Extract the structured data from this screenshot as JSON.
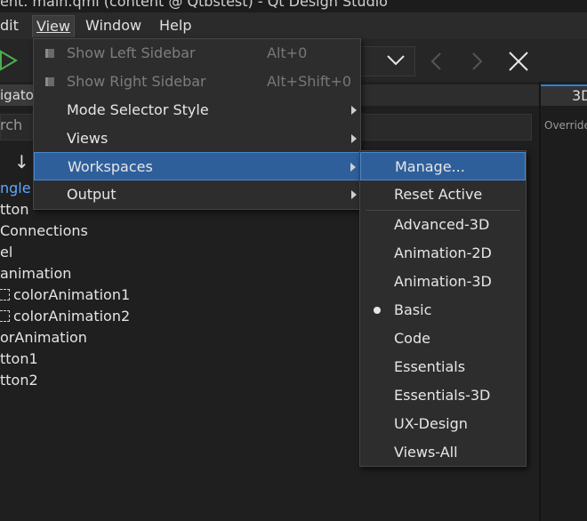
{
  "window": {
    "title": "ent. main.qml (content @ Qtbstest) - Qt Design Studio"
  },
  "menubar": {
    "items": [
      "dit",
      "View",
      "Window",
      "Help"
    ],
    "active": "View"
  },
  "toolbar": {
    "icons": [
      "play-icon",
      "chevron-down-icon",
      "back-arrow-icon",
      "forward-arrow-icon",
      "close-icon"
    ]
  },
  "left_panel": {
    "tab_label": "igator",
    "search_placeholder": "rch",
    "sort_icon": "↓",
    "tree": [
      {
        "label": "ngle",
        "selected": true
      },
      {
        "label": "tton"
      },
      {
        "label": " Connections"
      },
      {
        "label": "el"
      },
      {
        "label": "animation"
      },
      {
        "label": "colorAnimation1",
        "icon": true
      },
      {
        "label": "colorAnimation2",
        "icon": true
      },
      {
        "label": "orAnimation"
      },
      {
        "label": "tton1"
      },
      {
        "label": "tton2"
      }
    ]
  },
  "right_panel": {
    "tab_label": "3D",
    "override_label": "Override"
  },
  "view_menu": {
    "items": [
      {
        "label": "Show Left Sidebar",
        "shortcut": "Alt+0",
        "disabled": true
      },
      {
        "label": "Show Right Sidebar",
        "shortcut": "Alt+Shift+0",
        "disabled": true
      },
      {
        "label": "Mode Selector Style",
        "submenu": true
      },
      {
        "label": "Views",
        "submenu": true
      },
      {
        "label": "Workspaces",
        "submenu": true,
        "highlighted": true
      },
      {
        "label": "Output",
        "submenu": true
      }
    ]
  },
  "workspaces_menu": {
    "actions": [
      "Manage...",
      "Reset Active"
    ],
    "workspaces": [
      "Advanced-3D",
      "Animation-2D",
      "Animation-3D",
      "Basic",
      "Code",
      "Essentials",
      "Essentials-3D",
      "UX-Design",
      "Views-All"
    ],
    "current": "Basic"
  },
  "colors": {
    "highlight": "#2f5f9b",
    "accent": "#2a82da",
    "selected_tree_text": "#5fa8ff"
  }
}
